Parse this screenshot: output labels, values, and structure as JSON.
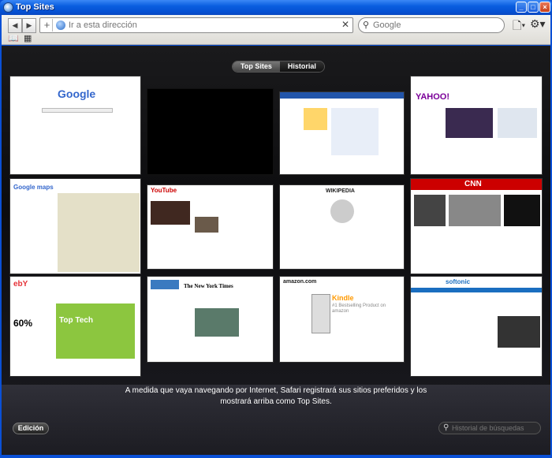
{
  "window": {
    "title": "Top Sites"
  },
  "toolbar": {
    "url_placeholder": "Ir a esta dirección",
    "search_placeholder": "Google"
  },
  "segmented": {
    "top_sites": "Top Sites",
    "history": "Historial"
  },
  "thumbnails": {
    "google": "Google",
    "yahoo": "YAHOO!",
    "google_maps": "Google maps",
    "youtube": "YouTube",
    "wikipedia": "WIKIPEDIA",
    "cnn": "CNN",
    "ebay": "ebY",
    "ebay_promo_title": "Top Tech",
    "ebay_promo_pct": "60%",
    "nyt": "The New York Times",
    "amazon": "amazon.com",
    "kindle": "Kindle",
    "kindle_sub": "#1 Bestselling Product on amazon",
    "softonic": "softonic"
  },
  "message": "A medida que vaya navegando por Internet, Safari registrará sus sitios preferidos y los mostrará arriba como Top Sites.",
  "footer": {
    "edit_label": "Edición",
    "history_search_placeholder": "Historial de búsquedas"
  }
}
